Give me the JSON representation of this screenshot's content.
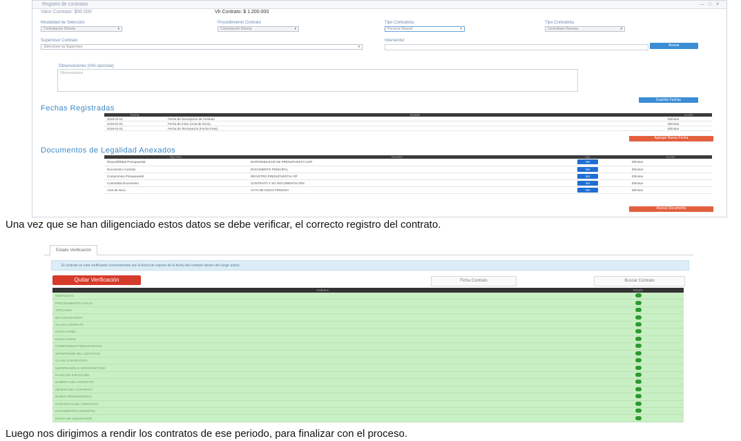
{
  "top_form": {
    "header_tab": "Registro de contratos",
    "valor_label": "Valor Contrato: $00.000",
    "valor_total": "Vlr Contrato: $ 1.200.000",
    "fields": [
      {
        "label": "Modalidad de Selección",
        "value": "Contratación Directa"
      },
      {
        "label": "Procedimiento Contrato",
        "value": "Contratación Directa"
      },
      {
        "label": "Tipo Contratista",
        "value": "Persona Natural"
      },
      {
        "label": "Tipo Contratista",
        "value": "Contratista Persona"
      }
    ],
    "supervisor_label": "Supervisor Contrato",
    "supervisor_value": "Seleccione un Supervisor",
    "interventor_label": "Interventor",
    "buscar_button": "Buscar",
    "observaciones_label": "Observaciones (Info opcional)",
    "observaciones_value": "Observaciones",
    "guardar_button": "Guardar Fechas"
  },
  "fechas": {
    "title": "Fechas Registradas",
    "headers": [
      "Fecha",
      "Detalle",
      "Acción"
    ],
    "rows": [
      [
        "2019-01-01",
        "Fecha de Suscripción de Contrato",
        "Eliminar"
      ],
      [
        "2019-01-01",
        "Fecha de Inicio (Acta de Inicio)",
        "Eliminar"
      ],
      [
        "2019-01-01",
        "Fecha de Terminación (Fecha Final)",
        "Eliminar"
      ]
    ],
    "button": "Agregar Nueva Fecha"
  },
  "documentos": {
    "title": "Documentos de Legalidad Anexados",
    "headers": [
      "Tipo Doc.",
      "Nombre",
      "Ver",
      "Acción"
    ],
    "rows": [
      [
        "Disponibilidad Presupuestal",
        "DISPONIBILIDAD DE PRESUPUESTO CDP",
        "Ver",
        "Eliminar"
      ],
      [
        "Documento Contrato",
        "DOCUMENTO PRINCIPAL",
        "Ver",
        "Eliminar"
      ],
      [
        "Compromiso Presupuestal",
        "REGISTRO PRESUPUESTAL RP",
        "Ver",
        "Eliminar"
      ],
      [
        "Contratista Documento",
        "CONTRATO Y SU DOCUMENTACIÓN",
        "Ver",
        "Eliminar"
      ],
      [
        "Acta de Inicio",
        "ACTA DE INICIO FIRMADA",
        "Ver",
        "Eliminar"
      ]
    ],
    "button": "Anexar Documento"
  },
  "paragraph1": "Una vez que se han diligenciado estos datos se debe verificar, el correcto registro del contrato.",
  "verification": {
    "tab": "Estado Verificación",
    "alert": "El contrato se está verificando correctamente por la fecha de reporte de la fecha del contrato dentro del rango activo",
    "quitar_button": "Quitar Verificación",
    "ficha_button": "Ficha Contrato",
    "buscar_button": "Buscar Contrato",
    "headers": [
      "Atributos",
      "Estado"
    ],
    "rows": [
      "MODALIDAD",
      "PROCEDIMIENTO FISCAL",
      "TIPOLOGÍA",
      "NIT CONTRATISTA",
      "VALOR CONTRATO",
      "FECHA FIRMA",
      "FECHA INICIO",
      "COMPROMISO PRESUPUESTAL",
      "SUPERVISOR DEL CONTRATO",
      "CLASE CONTRATISTA",
      "SUPERVISIÓN O INTERVENTORÍA",
      "PLAZO DE EJECUCIÓN",
      "NÚMERO DEL CONTRATO",
      "OBJETO DEL CONTRATO",
      "RUBRO PRESUPUESTAL",
      "GARANTÍAS DEL CONTRATO",
      "DOCUMENTOS ADJUNTOS",
      "FECHA DE LIQUIDACIÓN"
    ]
  },
  "paragraph2": "Luego nos dirigimos a rendir los contratos de ese periodo, para finalizar con el proceso."
}
